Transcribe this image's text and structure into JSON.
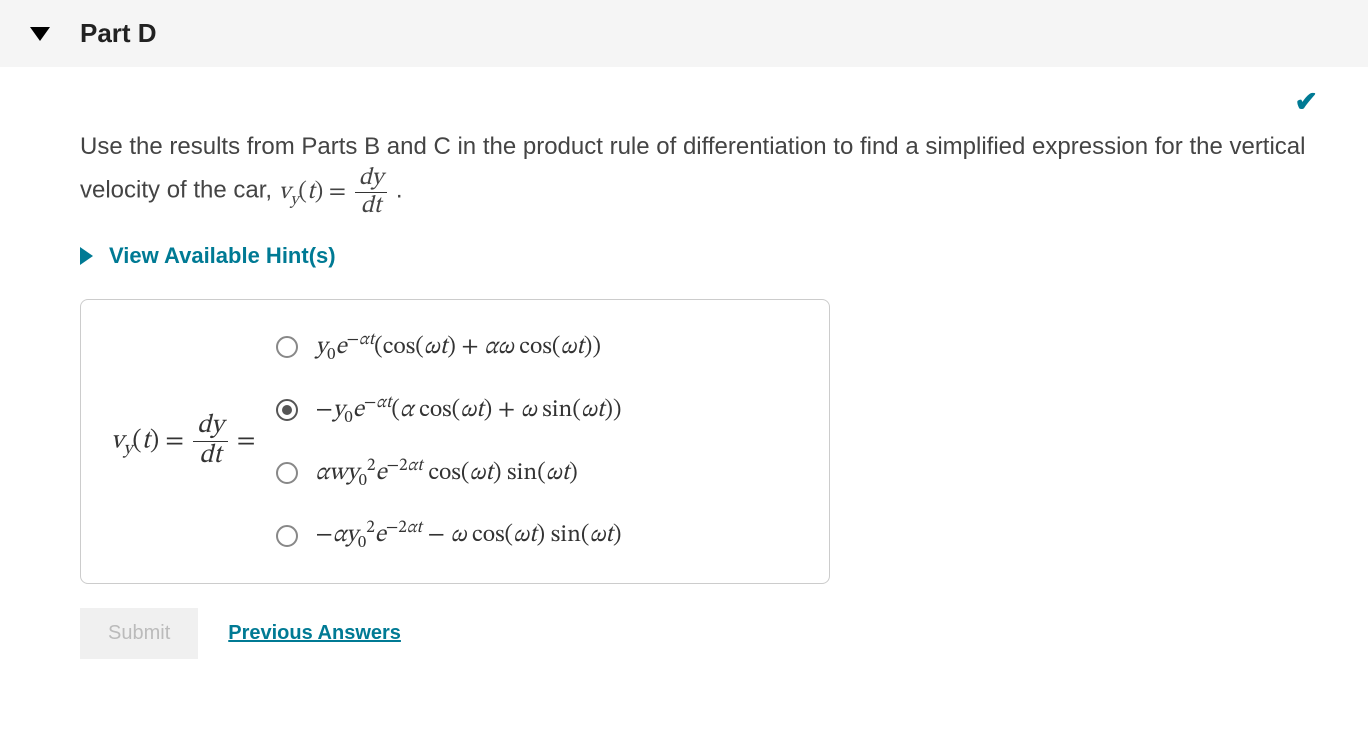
{
  "header": {
    "title": "Part D"
  },
  "status": {
    "correct": true
  },
  "question": {
    "text_before": "Use the results from Parts B and C in the product rule of differentiation to find a simplified expression for the vertical velocity of the car, ",
    "vy_label_html": "v_y(t)",
    "dy": "dy",
    "dt": "dt",
    "period": "."
  },
  "hints": {
    "label": "View Available Hint(s)"
  },
  "answer": {
    "lhs": {
      "vy": "v_y(t)",
      "dy": "dy",
      "dt": "dt"
    },
    "options": [
      {
        "id": "opt1",
        "selected": false,
        "expr": "y_0 e^{-αt} (cos(ωt) + αω cos(ωt))"
      },
      {
        "id": "opt2",
        "selected": true,
        "expr": "− y_0 e^{-αt} (α cos(ωt) + ω sin(ωt))"
      },
      {
        "id": "opt3",
        "selected": false,
        "expr": "α w y_0^2 e^{-2αt} cos(ωt) sin(ωt)"
      },
      {
        "id": "opt4",
        "selected": false,
        "expr": "− α y_0^2 e^{-2αt} − ω cos(ωt) sin(ωt)"
      }
    ]
  },
  "buttons": {
    "submit": "Submit",
    "previous": "Previous Answers"
  }
}
